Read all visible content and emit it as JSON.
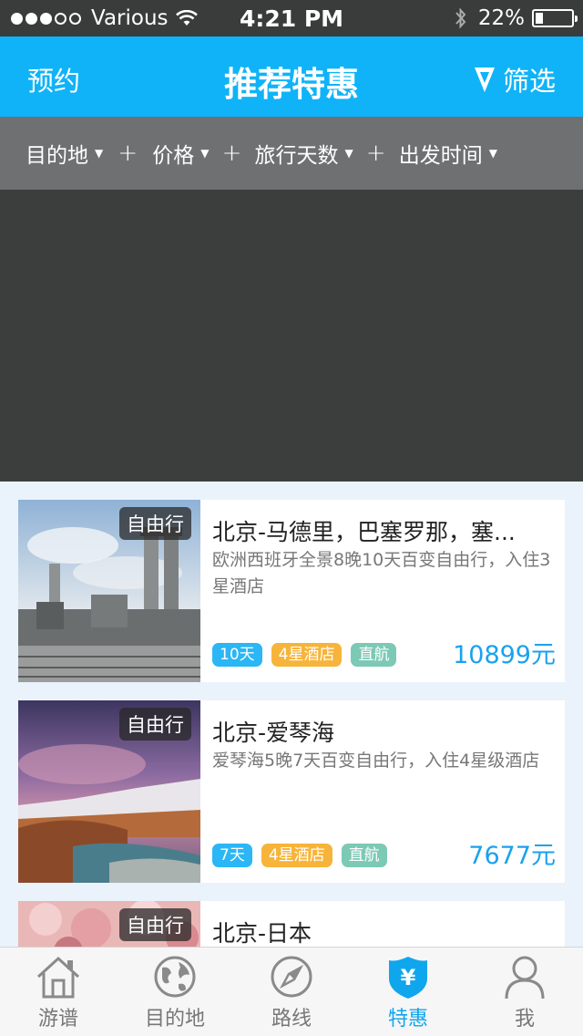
{
  "status_bar": {
    "carrier": "Various",
    "time": "4:21 PM",
    "battery_text": "22%",
    "battery_level": 0.22,
    "signal_bars_filled": 3,
    "signal_bars_total": 5
  },
  "nav": {
    "left_label": "预约",
    "title": "推荐特惠",
    "right_label": "筛选",
    "right_icon": "filter-icon"
  },
  "filters": [
    {
      "label": "目的地"
    },
    {
      "label": "价格"
    },
    {
      "label": "旅行天数"
    },
    {
      "label": "出发时间"
    }
  ],
  "filter_separator": "+",
  "cards": [
    {
      "tag": "自由行",
      "title": "北京-马德里，巴塞罗那，塞...",
      "desc": "欧洲西班牙全景8晚10天百变自由行，入住3星酒店",
      "badges": {
        "days": "10天",
        "hotel": "4星酒店",
        "flight": "直航"
      },
      "price": "10899元",
      "image": "temple-ruins"
    },
    {
      "tag": "自由行",
      "title": "北京-爱琴海",
      "desc": "爱琴海5晚7天百变自由行，入住4星级酒店",
      "badges": {
        "days": "7天",
        "hotel": "4星酒店",
        "flight": "直航"
      },
      "price": "7677元",
      "image": "coastal-town"
    },
    {
      "tag": "自由行",
      "title": "北京-日本",
      "desc": "",
      "badges": {
        "days": "",
        "hotel": "",
        "flight": ""
      },
      "price": "",
      "image": "cherry-blossom"
    }
  ],
  "tabs": [
    {
      "label": "游谱",
      "icon": "house-icon",
      "active": false
    },
    {
      "label": "目的地",
      "icon": "globe-icon",
      "active": false
    },
    {
      "label": "路线",
      "icon": "compass-icon",
      "active": false
    },
    {
      "label": "特惠",
      "icon": "yen-shield-icon",
      "active": true
    },
    {
      "label": "我",
      "icon": "person-icon",
      "active": false
    }
  ],
  "colors": {
    "primary": "#10b3f7",
    "filter_bar": "#6e7071",
    "banner": "#3c3e3e",
    "price": "#1aa2ee",
    "badge_days": "#2bb6f5",
    "badge_hotel": "#f7b43a",
    "badge_flight": "#7cc9b5"
  }
}
